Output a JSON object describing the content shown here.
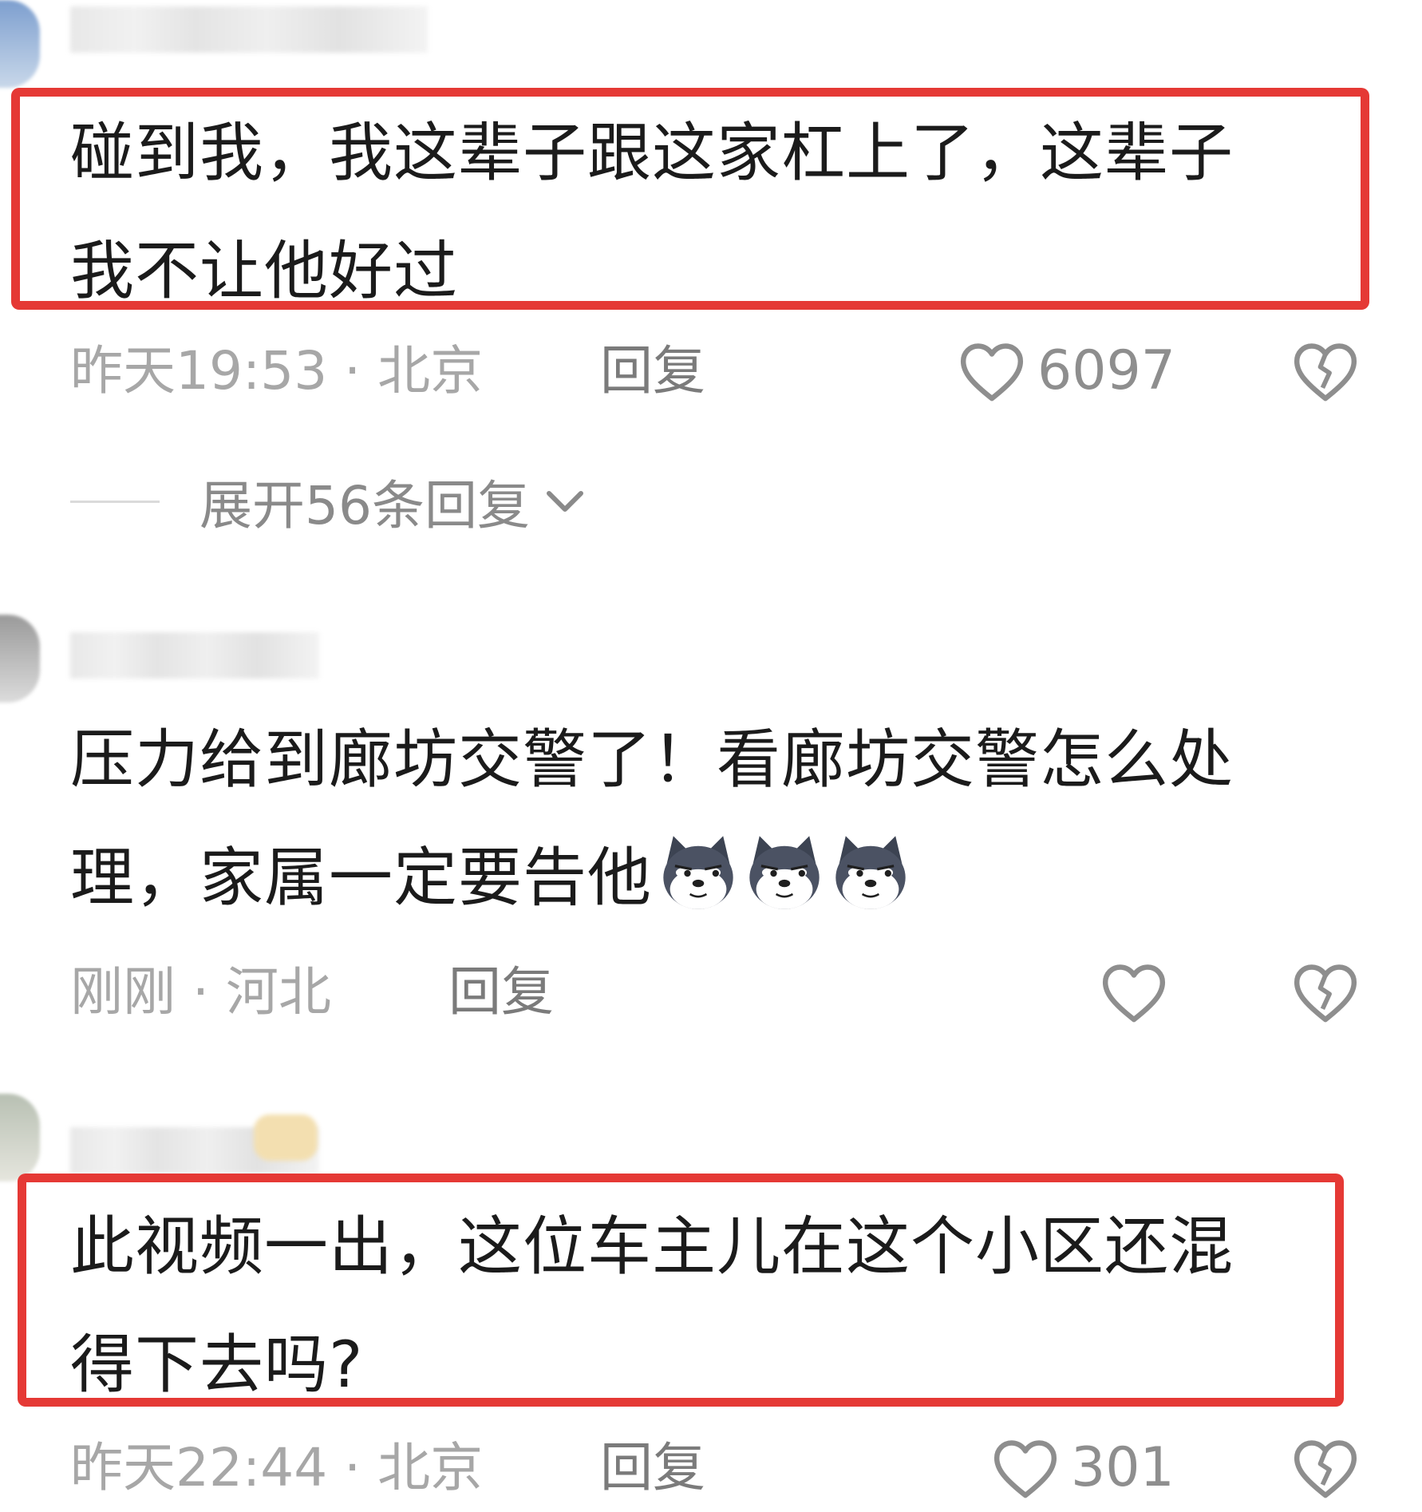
{
  "comments": [
    {
      "text_lines": [
        "碰到我，我这辈子跟这家杠上了，这辈子",
        "我不让他好过"
      ],
      "time_location": "昨天19:53 · 北京",
      "reply_label": "回复",
      "like_count": "6097",
      "highlighted": true
    },
    {
      "text_lines": [
        "压力给到廊坊交警了！看廊坊交警怎么处",
        "理，家属一定要告他"
      ],
      "emoji": [
        "husky-side-eye-emoji",
        "husky-side-eye-emoji",
        "husky-side-eye-emoji"
      ],
      "time_location": "刚刚 · 河北",
      "reply_label": "回复",
      "like_count": "",
      "highlighted": false
    },
    {
      "text_lines": [
        "此视频一出，这位车主儿在这个小区还混",
        "得下去吗?"
      ],
      "time_location": "昨天22:44 · 北京",
      "reply_label": "回复",
      "like_count": "301",
      "highlighted": true
    }
  ],
  "expand_replies_label": "展开56条回复",
  "icons": {
    "like": "heart-outline-icon",
    "dislike": "broken-heart-icon",
    "expand": "chevron-down-icon"
  },
  "colors": {
    "highlight_border": "#e53935",
    "body_text": "#1b1b1b",
    "meta_text": "#a7a7a7"
  }
}
